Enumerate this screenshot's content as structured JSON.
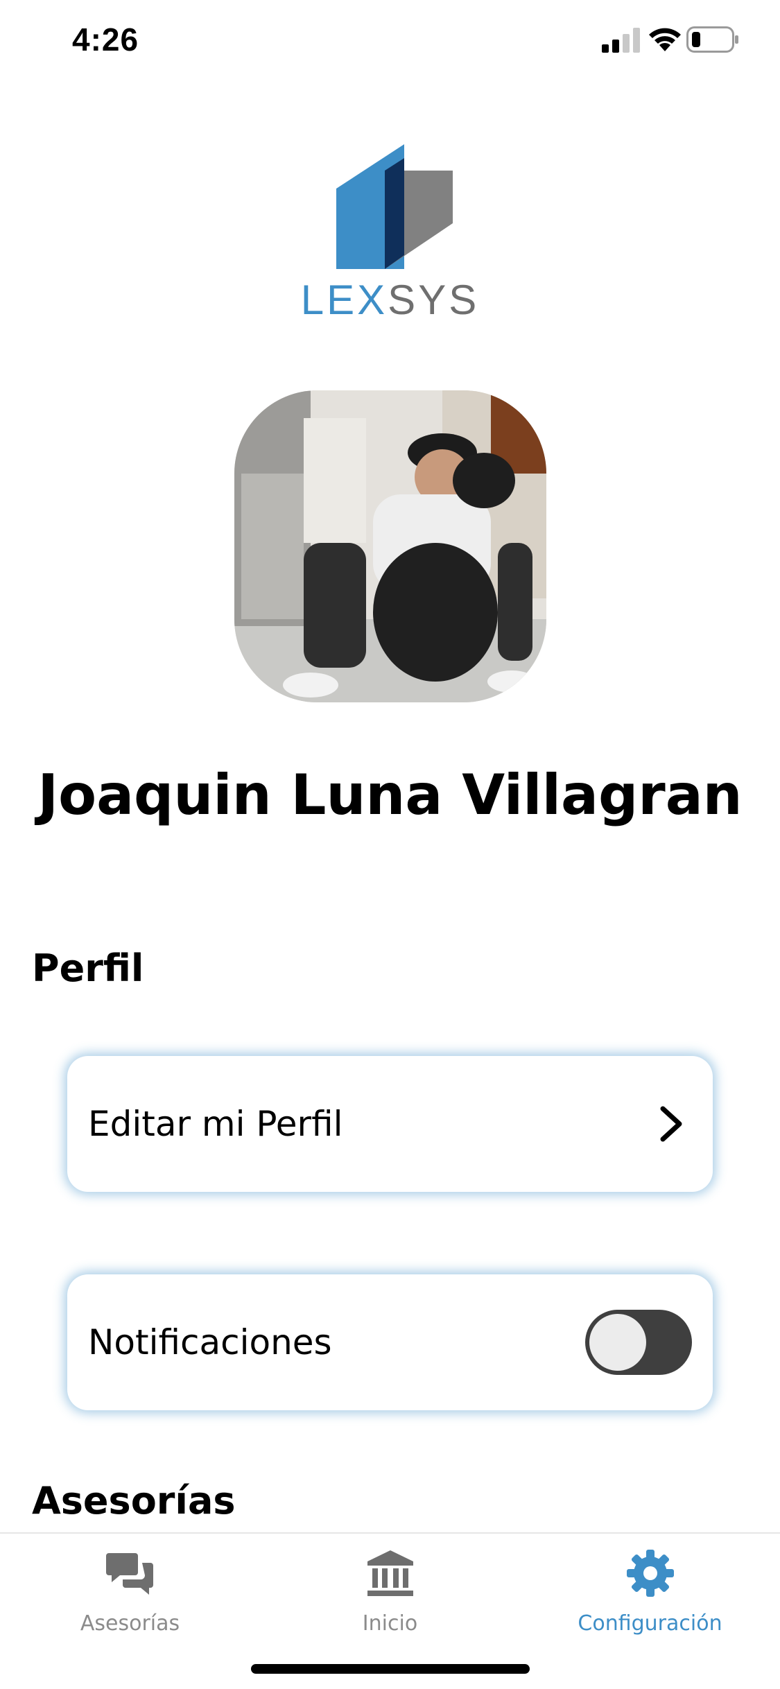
{
  "status_bar": {
    "time": "4:26"
  },
  "brand": {
    "logo_part1": "LEX",
    "logo_part2": "SYS",
    "primary_color": "#3d8ec7",
    "secondary_color": "#6f6f6f"
  },
  "profile": {
    "name": "Joaquin Luna Villagran"
  },
  "sections": {
    "perfil": {
      "title": "Perfil"
    },
    "asesorias": {
      "title": "Asesorías"
    }
  },
  "settings": {
    "edit_profile": {
      "label": "Editar mi Perfil",
      "icon": "chevron-right-icon"
    },
    "notifications": {
      "label": "Notificaciones",
      "enabled": false
    }
  },
  "tab_bar": {
    "items": [
      {
        "label": "Asesorías",
        "icon": "chat-icon",
        "active": false
      },
      {
        "label": "Inicio",
        "icon": "bank-icon",
        "active": false
      },
      {
        "label": "Configuración",
        "icon": "gear-icon",
        "active": true
      }
    ],
    "active_color": "#3d8ec7",
    "inactive_color": "#8b8b8b"
  }
}
